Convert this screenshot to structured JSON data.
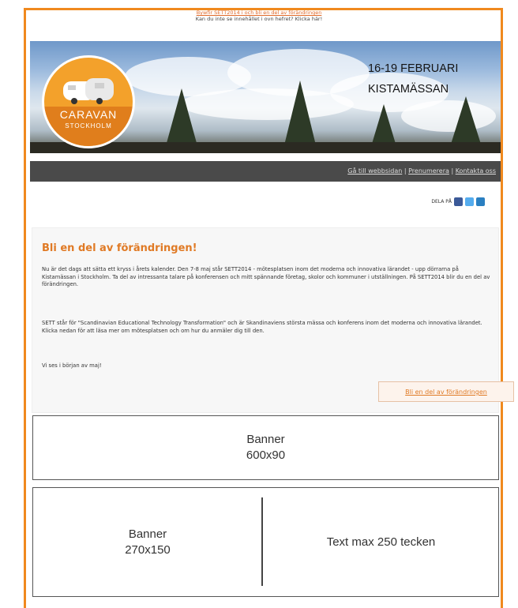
{
  "top": {
    "link_text": "Bywfir SETT2014 i och bli en del av förändringen",
    "fallback_text": "Kan du inte se innehållet i ovn hefret? Klicka här!"
  },
  "hero": {
    "dates": "16-19 FEBRUARI",
    "venue": "KISTAMÄSSAN",
    "badge_brand": "CARAVAN",
    "badge_sub": "STOCKHOLM"
  },
  "nav": {
    "items": [
      "Gå till webbsidan",
      "Prenumerera",
      "Kontakta oss"
    ],
    "separator": " | "
  },
  "share": {
    "label": "DELA PÅ",
    "icons": [
      "facebook-icon",
      "twitter-icon",
      "linkedin-icon"
    ],
    "colors": [
      "#3b5998",
      "#55acee",
      "#2a7fc1"
    ]
  },
  "article": {
    "title": "Bli en del av förändringen!",
    "p1": "Nu är det dags att sätta ett kryss i årets kalender. Den 7-8 maj står SETT2014 - mötesplatsen inom det moderna och innovativa lärandet - upp dörrarna på Kistamässan i Stockholm. Ta del av intressanta talare på konferensen och mitt spännande företag, skolor och kommuner i utställningen. På SETT2014 blir du en del av förändringen.",
    "p2": "SETT står för \"Scandinavian Educational Technology Transformation\" och är Skandinaviens största mässa och konferens inom det moderna och innovativa lärandet. Klicka nedan för att läsa mer om mötesplatsen och om hur du anmäler dig till den.",
    "p3": "Vi ses i början av maj!",
    "cta": "Bli en del av förändringen"
  },
  "banner_top": {
    "label": "Banner",
    "size": "600x90"
  },
  "banner_bottom": {
    "label": "Banner",
    "size": "270x150",
    "text": "Text max 250 tecken"
  },
  "colors": {
    "accent": "#f0891e",
    "heading": "#e07a25",
    "nav_bg": "#4a4a4a"
  }
}
